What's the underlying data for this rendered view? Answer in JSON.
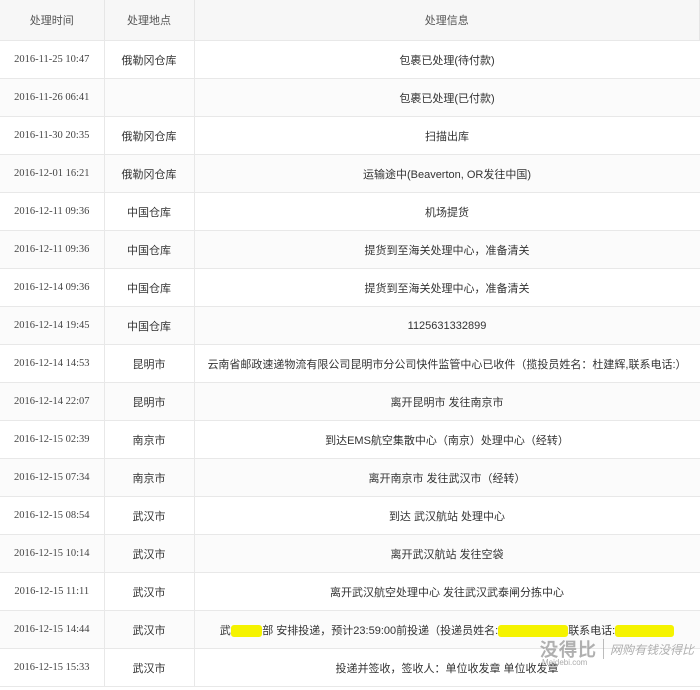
{
  "headers": {
    "time": "处理时间",
    "location": "处理地点",
    "info": "处理信息"
  },
  "rows": [
    {
      "time": "2016-11-25 10:47",
      "location": "俄勒冈仓库",
      "info": "包裹已处理(待付款)"
    },
    {
      "time": "2016-11-26 06:41",
      "location": "",
      "info": "包裹已处理(已付款)"
    },
    {
      "time": "2016-11-30 20:35",
      "location": "俄勒冈仓库",
      "info": "扫描出库"
    },
    {
      "time": "2016-12-01 16:21",
      "location": "俄勒冈仓库",
      "info": "运输途中(Beaverton, OR发往中国)"
    },
    {
      "time": "2016-12-11 09:36",
      "location": "中国仓库",
      "info": "机场提货"
    },
    {
      "time": "2016-12-11 09:36",
      "location": "中国仓库",
      "info": "提货到至海关处理中心，准备清关"
    },
    {
      "time": "2016-12-14 09:36",
      "location": "中国仓库",
      "info": "提货到至海关处理中心，准备清关"
    },
    {
      "time": "2016-12-14 19:45",
      "location": "中国仓库",
      "info": "1125631332899"
    },
    {
      "time": "2016-12-14 14:53",
      "location": "昆明市",
      "info": "云南省邮政速递物流有限公司昆明市分公司快件监管中心已收件（揽投员姓名：杜建辉,联系电话:）"
    },
    {
      "time": "2016-12-14 22:07",
      "location": "昆明市",
      "info": "离开昆明市 发往南京市"
    },
    {
      "time": "2016-12-15 02:39",
      "location": "南京市",
      "info": "到达EMS航空集散中心（南京）处理中心（经转）"
    },
    {
      "time": "2016-12-15 07:34",
      "location": "南京市",
      "info": "离开南京市 发往武汉市（经转）"
    },
    {
      "time": "2016-12-15 08:54",
      "location": "武汉市",
      "info": "到达 武汉航站 处理中心"
    },
    {
      "time": "2016-12-15 10:14",
      "location": "武汉市",
      "info": "离开武汉航站 发往空袋"
    },
    {
      "time": "2016-12-15 11:11",
      "location": "武汉市",
      "info": "离开武汉航空处理中心 发往武汉武泰闸分拣中心"
    },
    {
      "time": "2016-12-15 14:44",
      "location": "武汉市",
      "info_parts": [
        "武",
        "部 安排投递，预计23:59:00前投递（投递员姓名:",
        "联系电话:",
        ""
      ]
    },
    {
      "time": "2016-12-15 15:33",
      "location": "武汉市",
      "info": "投递并签收，签收人：单位收发章 单位收发章"
    }
  ],
  "watermark": {
    "logo": "没得比",
    "site": "Meidebi.com",
    "slogan": "网购有钱没得比"
  }
}
